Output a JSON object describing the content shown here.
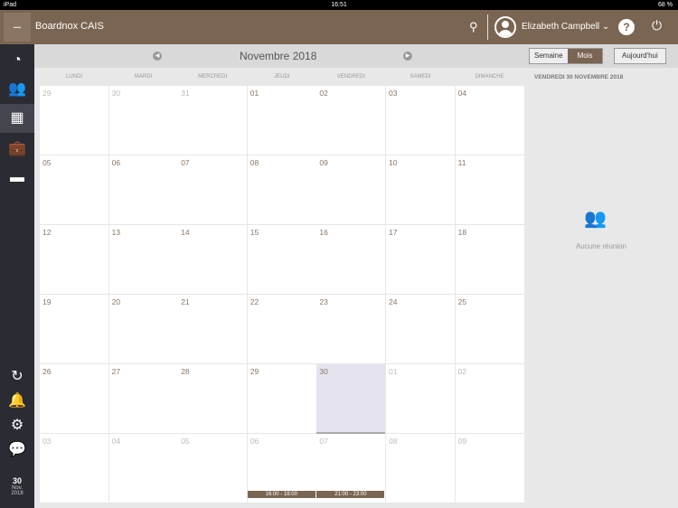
{
  "status": {
    "device": "iPad",
    "time": "16:51",
    "battery": "68 %"
  },
  "header": {
    "logo": "BOARDNOX",
    "title": "Boardnox CAIS",
    "user": "Elizabeth  Campbell ⌄",
    "help": "?"
  },
  "sidebar": {
    "date_day": "30",
    "date_month": "Nov.",
    "date_year": "2018"
  },
  "toolbar": {
    "month": "Novembre 2018",
    "week_label": "Semaine",
    "month_label": "Mois",
    "today_label": "Aujourd'hui"
  },
  "weekdays": [
    "LUNDI",
    "MARDI",
    "MERCREDI",
    "JEUDI",
    "VENDREDI",
    "SAMEDI",
    "DIMANCHE"
  ],
  "weeks": [
    [
      {
        "d": "29",
        "out": true
      },
      {
        "d": "30",
        "out": true
      },
      {
        "d": "31",
        "out": true
      },
      {
        "d": "01"
      },
      {
        "d": "02"
      },
      {
        "d": "03"
      },
      {
        "d": "04"
      }
    ],
    [
      {
        "d": "05"
      },
      {
        "d": "06"
      },
      {
        "d": "07"
      },
      {
        "d": "08"
      },
      {
        "d": "09"
      },
      {
        "d": "10"
      },
      {
        "d": "11"
      }
    ],
    [
      {
        "d": "12"
      },
      {
        "d": "13"
      },
      {
        "d": "14"
      },
      {
        "d": "15"
      },
      {
        "d": "16"
      },
      {
        "d": "17"
      },
      {
        "d": "18"
      }
    ],
    [
      {
        "d": "19"
      },
      {
        "d": "20"
      },
      {
        "d": "21"
      },
      {
        "d": "22"
      },
      {
        "d": "23"
      },
      {
        "d": "24"
      },
      {
        "d": "25"
      }
    ],
    [
      {
        "d": "26"
      },
      {
        "d": "27"
      },
      {
        "d": "28"
      },
      {
        "d": "29"
      },
      {
        "d": "30",
        "selected": true
      },
      {
        "d": "01",
        "out": true
      },
      {
        "d": "02",
        "out": true
      }
    ],
    [
      {
        "d": "03",
        "out": true
      },
      {
        "d": "04",
        "out": true
      },
      {
        "d": "05",
        "out": true
      },
      {
        "d": "06",
        "out": true,
        "event": "16:00 - 18:00"
      },
      {
        "d": "07",
        "out": true,
        "event": "21:00 - 23:00"
      },
      {
        "d": "08",
        "out": true
      },
      {
        "d": "09",
        "out": true
      }
    ]
  ],
  "panel": {
    "title": "VENDREDI 30 NOVEMBRE 2018",
    "empty": "Aucune réunion"
  }
}
